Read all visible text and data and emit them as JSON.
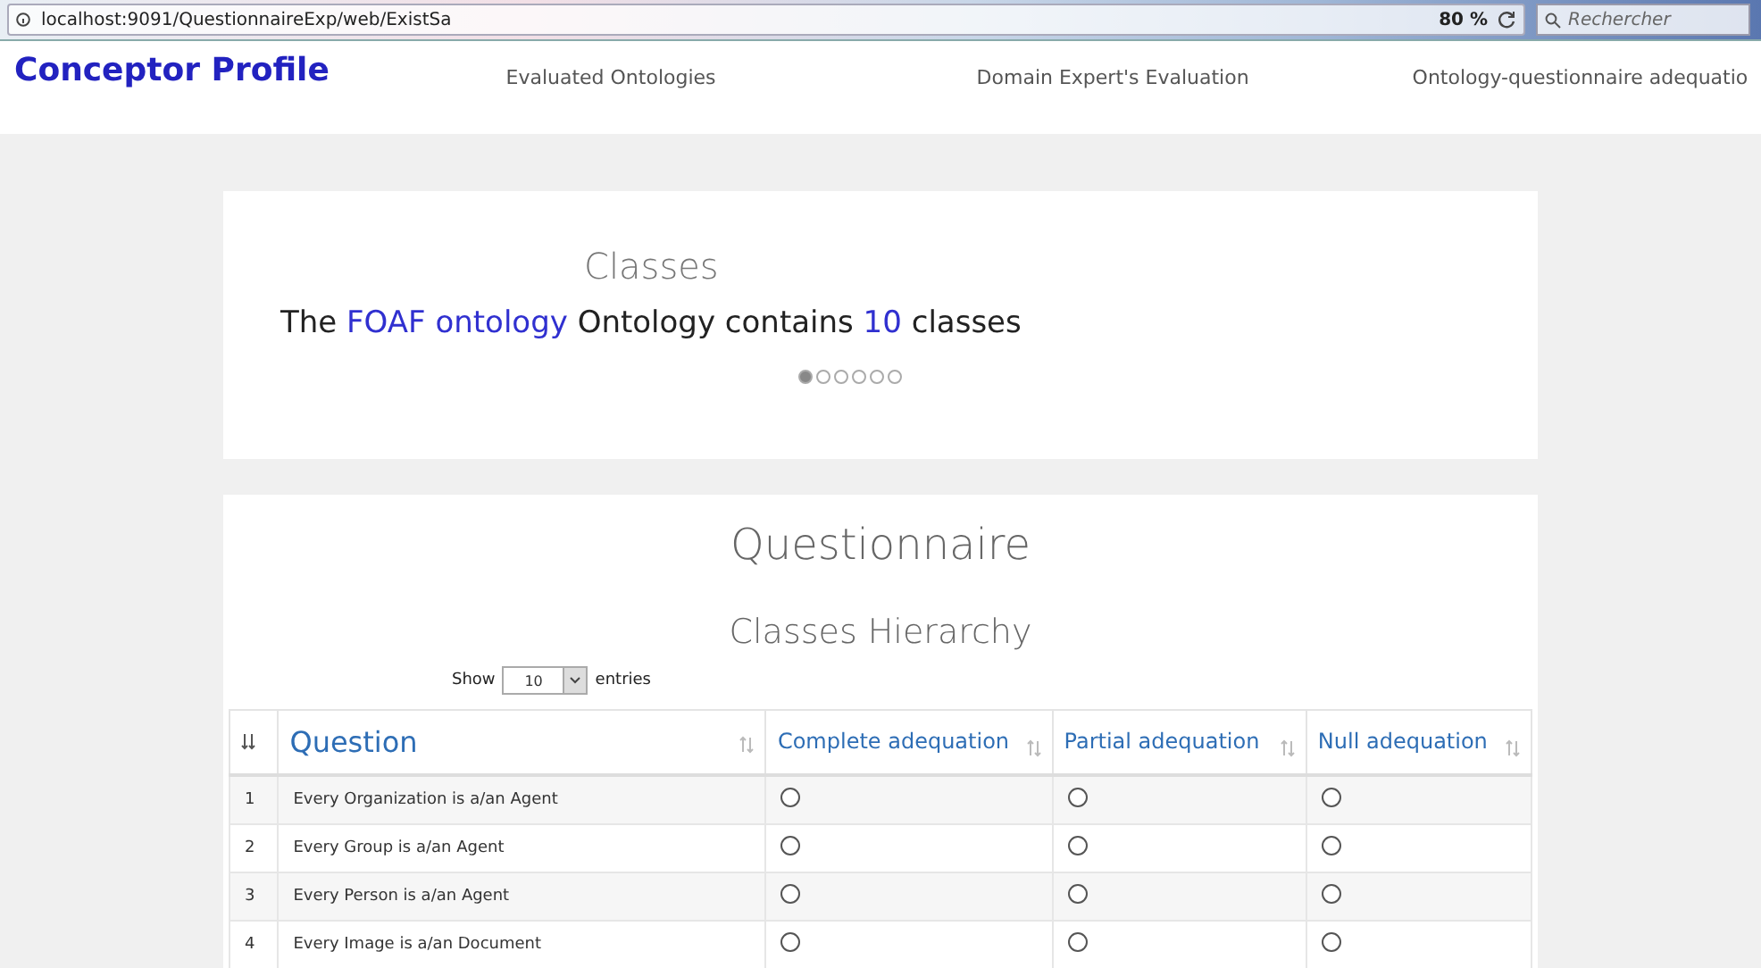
{
  "browser": {
    "url": "localhost:9091/QuestionnaireExp/web/ExistSa",
    "zoom": "80 %",
    "search": {
      "placeholder": "Rechercher"
    }
  },
  "nav": {
    "brand": "Conceptor Profile",
    "links": [
      {
        "label": "Evaluated Ontologies"
      },
      {
        "label": "Domain Expert's Evaluation"
      },
      {
        "label": "Ontology-questionnaire adequatio"
      }
    ]
  },
  "classes_card": {
    "title": "Classes",
    "sentence": [
      {
        "kind": "plain",
        "text": "The"
      },
      {
        "kind": "link",
        "text": "FOAF ontology"
      },
      {
        "kind": "plain",
        "text": "Ontology contains"
      },
      {
        "kind": "count",
        "text": "10"
      },
      {
        "kind": "plain",
        "text": "classes"
      }
    ],
    "dots": [
      {
        "selected": true
      },
      {
        "selected": false
      },
      {
        "selected": false
      },
      {
        "selected": false
      },
      {
        "selected": false
      },
      {
        "selected": false
      }
    ]
  },
  "questionnaire": {
    "title": "Questionnaire",
    "subtitle": "Classes Hierarchy",
    "length": {
      "before": "Show",
      "value": "10",
      "after": "entries"
    },
    "table": {
      "columns": [
        "Question",
        "Complete adequation",
        "Partial adequation",
        "Null adequation"
      ],
      "rows": [
        {
          "index": "1",
          "question": "Every Organization is a/an Agent",
          "choices": [
            {
              "selected": false
            },
            {
              "selected": false
            },
            {
              "selected": false
            }
          ]
        },
        {
          "index": "2",
          "question": "Every Group is a/an Agent",
          "choices": [
            {
              "selected": false
            },
            {
              "selected": false
            },
            {
              "selected": false
            }
          ]
        },
        {
          "index": "3",
          "question": "Every Person is a/an Agent",
          "choices": [
            {
              "selected": false
            },
            {
              "selected": false
            },
            {
              "selected": false
            }
          ]
        },
        {
          "index": "4",
          "question": "Every Image is a/an Document",
          "choices": [
            {
              "selected": false
            },
            {
              "selected": false
            },
            {
              "selected": false
            }
          ]
        }
      ]
    }
  }
}
